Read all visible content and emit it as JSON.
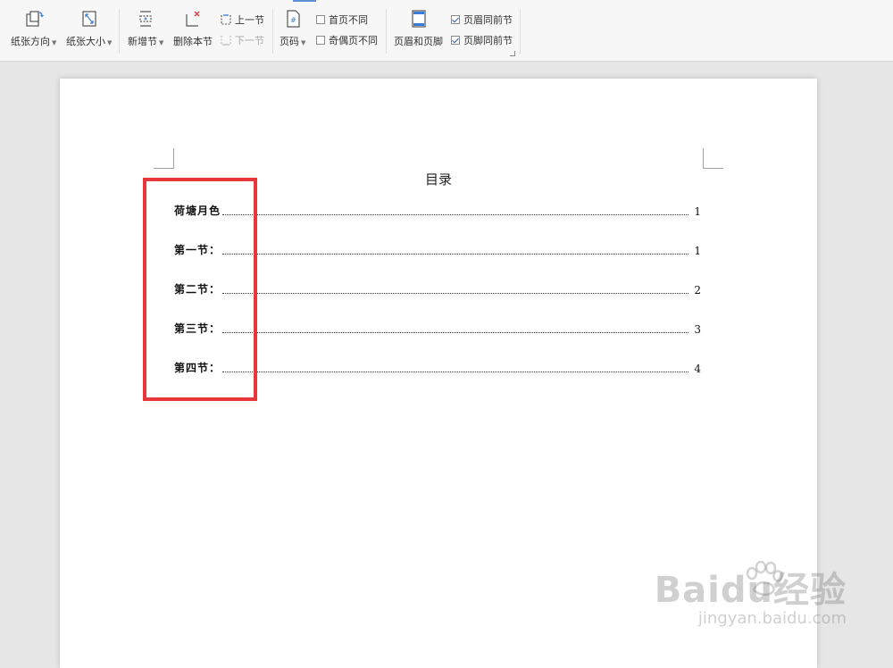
{
  "ribbon": {
    "paper_orientation": "纸张方向",
    "paper_size": "纸张大小",
    "new_section": "新增节",
    "delete_section": "删除本节",
    "prev_section": "上一节",
    "next_section": "下一节",
    "page_number": "页码",
    "first_page_different": "首页不同",
    "odd_even_different": "奇偶页不同",
    "header_footer": "页眉和页脚",
    "header_same_as_prev": "页眉同前节",
    "footer_same_as_prev": "页脚同前节"
  },
  "document": {
    "toc_title": "目录",
    "toc_entries": [
      {
        "text": "荷塘月色",
        "page": "1"
      },
      {
        "text": "第一节：",
        "page": "1"
      },
      {
        "text": "第二节：",
        "page": "2"
      },
      {
        "text": "第三节：",
        "page": "3"
      },
      {
        "text": "第四节：",
        "page": "4"
      }
    ]
  },
  "watermark": {
    "brand": "Baidu经验",
    "url": "jingyan.baidu.com"
  },
  "colors": {
    "highlight": "#e8363a",
    "checkbox_check": "#2f5fb5"
  }
}
